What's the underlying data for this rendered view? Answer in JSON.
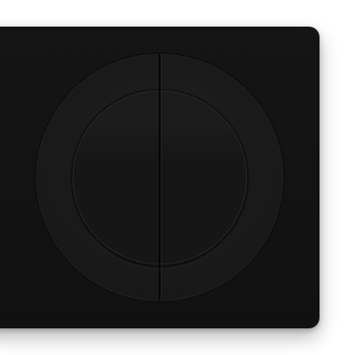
{
  "panel": {
    "background": "#131313",
    "ring_color": "#1b1b1b",
    "edge_highlight": "#3a3a3a"
  },
  "dial": {
    "left_half": {
      "icon": "half-circle-left"
    },
    "right_half": {
      "icon": "half-circle-right"
    },
    "outer_ring": {
      "icon": "ring"
    }
  }
}
